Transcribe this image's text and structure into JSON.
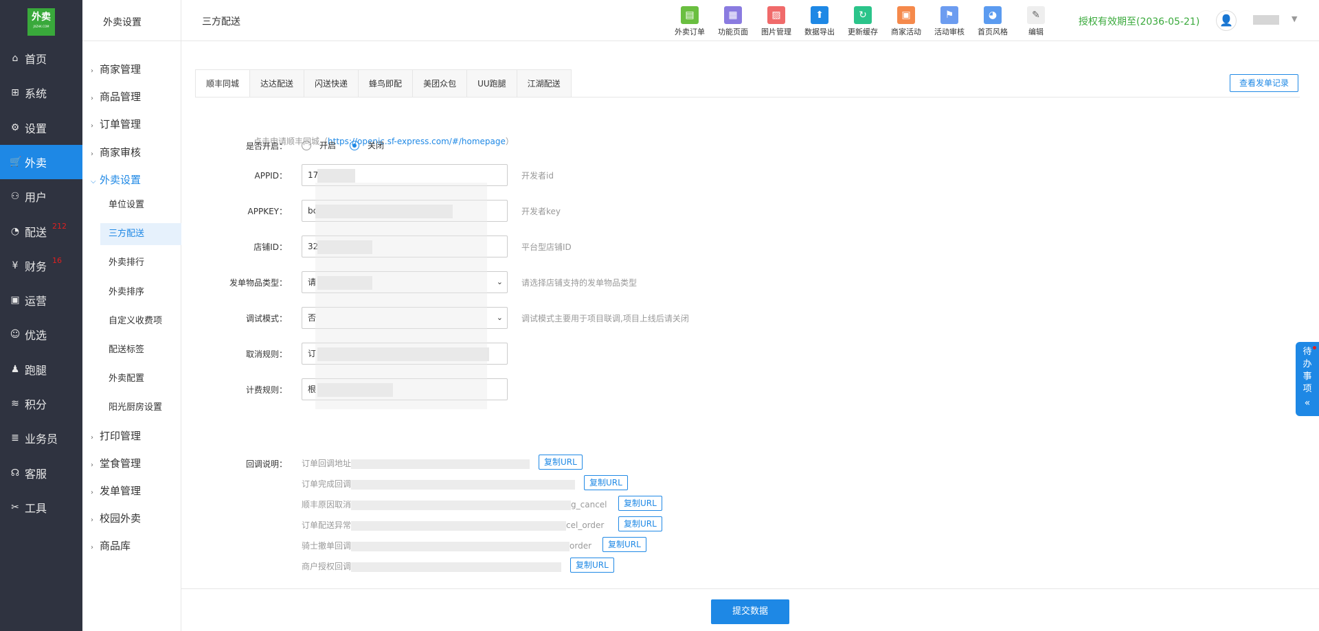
{
  "logo": {
    "text": "外卖",
    "sub": "JXZHK.COM"
  },
  "sidebar": {
    "items": [
      {
        "label": "首页",
        "icon": "home-icon",
        "glyph": "⌂"
      },
      {
        "label": "系统",
        "icon": "windows-icon",
        "glyph": "⊞"
      },
      {
        "label": "设置",
        "icon": "gear-icon",
        "glyph": "⚙"
      },
      {
        "label": "外卖",
        "icon": "cart-icon",
        "glyph": "🛒",
        "active": true
      },
      {
        "label": "用户",
        "icon": "user-icon",
        "glyph": "⚇"
      },
      {
        "label": "配送",
        "icon": "gauge-icon",
        "glyph": "◔",
        "badge": "212"
      },
      {
        "label": "财务",
        "icon": "yen-icon",
        "glyph": "¥",
        "badge": "16"
      },
      {
        "label": "运营",
        "icon": "gift-icon",
        "glyph": "▣"
      },
      {
        "label": "优选",
        "icon": "smile-icon",
        "glyph": "☺"
      },
      {
        "label": "跑腿",
        "icon": "person-icon",
        "glyph": "♟"
      },
      {
        "label": "积分",
        "icon": "signal-icon",
        "glyph": "≋"
      },
      {
        "label": "业务员",
        "icon": "stack-icon",
        "glyph": "≣"
      },
      {
        "label": "客服",
        "icon": "headset-icon",
        "glyph": "☊"
      },
      {
        "label": "工具",
        "icon": "tools-icon",
        "glyph": "✂"
      }
    ]
  },
  "subnav": {
    "title": "外卖设置",
    "groups_top": [
      "商家管理",
      "商品管理",
      "订单管理",
      "商家审核"
    ],
    "open_group": "外卖设置",
    "items": [
      "单位设置",
      "三方配送",
      "外卖排行",
      "外卖排序",
      "自定义收费项",
      "配送标签",
      "外卖配置",
      "阳光厨房设置"
    ],
    "active_item": "三方配送",
    "groups_bottom": [
      "打印管理",
      "堂食管理",
      "发单管理",
      "校园外卖",
      "商品库"
    ]
  },
  "topbar": {
    "title": "三方配送",
    "tools": [
      {
        "label": "外卖订单",
        "icon": "order-icon",
        "color": "#6abf40",
        "glyph": "▤"
      },
      {
        "label": "功能页面",
        "icon": "apps-icon",
        "color": "#8a7be0",
        "glyph": "▦"
      },
      {
        "label": "图片管理",
        "icon": "image-icon",
        "color": "#f06a6a",
        "glyph": "▨"
      },
      {
        "label": "数据导出",
        "icon": "upload-icon",
        "color": "#1e88e5",
        "glyph": "⬆"
      },
      {
        "label": "更新缓存",
        "icon": "refresh-icon",
        "color": "#2bc48a",
        "glyph": "↻"
      },
      {
        "label": "商家活动",
        "icon": "gift-icon",
        "color": "#f5894b",
        "glyph": "▣"
      },
      {
        "label": "活动审核",
        "icon": "flag-icon",
        "color": "#6c9cf0",
        "glyph": "⚑"
      },
      {
        "label": "首页风格",
        "icon": "palette-icon",
        "color": "#5b9bf0",
        "glyph": "◕"
      },
      {
        "label": "编辑",
        "icon": "edit-icon",
        "color": "#eeeeee",
        "glyph": "✎"
      }
    ],
    "license": "授权有效期至(2036-05-21)"
  },
  "tabs": [
    "顺丰同城",
    "达达配送",
    "闪送快递",
    "蜂鸟即配",
    "美团众包",
    "UU跑腿",
    "江湖配送"
  ],
  "active_tab": "顺丰同城",
  "record_button": "查看发单记录",
  "apply": {
    "text": "点击申请顺丰同城（",
    "link": "https://openic.sf-express.com/#/homepage",
    "end": "）"
  },
  "form": {
    "enabled": {
      "label": "是否开启：",
      "opt_on": "开启",
      "opt_off": "关闭",
      "selected": "关闭"
    },
    "appid": {
      "label": "APPID：",
      "value": "17",
      "hint": "开发者id"
    },
    "appkey": {
      "label": "APPKEY：",
      "value": "bc",
      "hint": "开发者key"
    },
    "shop_id": {
      "label": "店铺ID：",
      "value": "32",
      "hint": "平台型店铺ID"
    },
    "goods_type": {
      "label": "发单物品类型：",
      "value": "请",
      "hint": "请选择店铺支持的发单物品类型"
    },
    "debug": {
      "label": "调试模式：",
      "value": "否",
      "hint": "调试模式主要用于项目联调,项目上线后请关闭"
    },
    "cancel_rule": {
      "label": "取消规则：",
      "value": "订"
    },
    "fee_rule": {
      "label": "计费规则：",
      "value": "根"
    }
  },
  "callbacks": {
    "label": "回调说明：",
    "copy": "复制URL",
    "lines": [
      {
        "prefix": "订单回调地址",
        "suffix": ""
      },
      {
        "prefix": "订单完成回调",
        "suffix": ""
      },
      {
        "prefix": "顺丰原因取消",
        "suffix": "g_cancel"
      },
      {
        "prefix": "订单配送异常",
        "suffix": "cel_order"
      },
      {
        "prefix": "骑士撤单回调",
        "suffix": "order"
      },
      {
        "prefix": "商户授权回调",
        "suffix": ""
      }
    ]
  },
  "submit": "提交数据",
  "todo": "待办事项"
}
